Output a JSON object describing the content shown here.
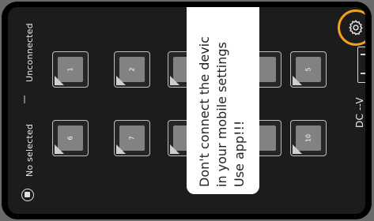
{
  "status": {
    "unconnected": "Unconnected",
    "no_selected": "No selected"
  },
  "devices": [
    {
      "label": "1"
    },
    {
      "label": "2"
    },
    {
      "label": ""
    },
    {
      "label": ""
    },
    {
      "label": "5"
    },
    {
      "label": "6"
    },
    {
      "label": "7"
    },
    {
      "label": ""
    },
    {
      "label": ""
    },
    {
      "label": "10"
    }
  ],
  "toast": {
    "line1": "Don't connect the devic",
    "line2": "in your mobile settings",
    "line3": "Use app!!!"
  },
  "dc_label": "DC --V",
  "colors": {
    "accent": "#f0a21b",
    "tile_inner": "#828282",
    "background": "#1c1c1c"
  },
  "icons": {
    "settings": "gear-icon",
    "selection": "select-circle-icon"
  }
}
